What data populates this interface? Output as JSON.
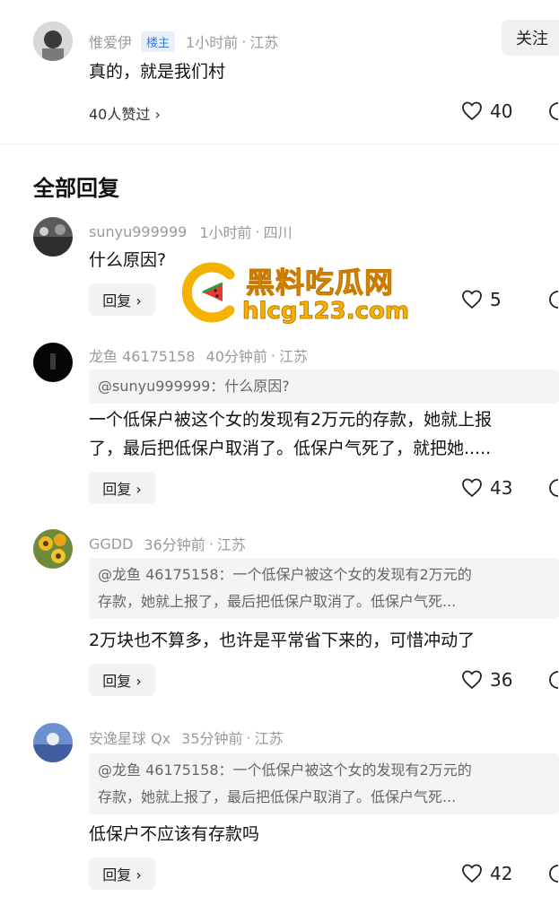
{
  "top_comment": {
    "author": "惟爱伊",
    "badge": "楼主",
    "time": "1小时前",
    "location": "江苏",
    "follow_label": "关注",
    "text": "真的，就是我们村",
    "likes_link": "40人赞过 ›",
    "like_count": "40"
  },
  "section_title": "全部回复",
  "replies": [
    {
      "author": "sunyu999999",
      "time": "1小时前",
      "location": "四川",
      "quote": "",
      "text": "什么原因?",
      "reply_label": "回复 ›",
      "like_count": "5"
    },
    {
      "author": "龙鱼 46175158",
      "time": "40分钟前",
      "location": "江苏",
      "quote": "@sunyu999999：什么原因?",
      "text_line1": "一个低保户被这个女的发现有2万元的存款，她就上报",
      "text_line2": "了，最后把低保户取消了。低保户气死了，就把她.....",
      "reply_label": "回复 ›",
      "like_count": "43"
    },
    {
      "author": "GGDD",
      "time": "36分钟前",
      "location": "江苏",
      "quote_line1": "@龙鱼 46175158：一个低保户被这个女的发现有2万元的",
      "quote_line2": "存款，她就上报了，最后把低保户取消了。低保户气死...",
      "text": "2万块也不算多，也许是平常省下来的，可惜冲动了",
      "reply_label": "回复 ›",
      "like_count": "36"
    },
    {
      "author": "安逸星球 Qx",
      "time": "35分钟前",
      "location": "江苏",
      "quote_line1": "@龙鱼 46175158：一个低保户被这个女的发现有2万元的",
      "quote_line2": "存款，她就上报了，最后把低保户取消了。低保户气死...",
      "text": "低保户不应该有存款吗",
      "reply_label": "回复 ›",
      "like_count": "42"
    }
  ],
  "watermark": {
    "name": "黑料吃瓜网",
    "url": "hlcg123.com"
  },
  "colors": {
    "badge_bg": "#e8f0fd",
    "badge_text": "#3a7be0",
    "watermark": "#f3b300",
    "meta_text": "#9a9a9a"
  }
}
